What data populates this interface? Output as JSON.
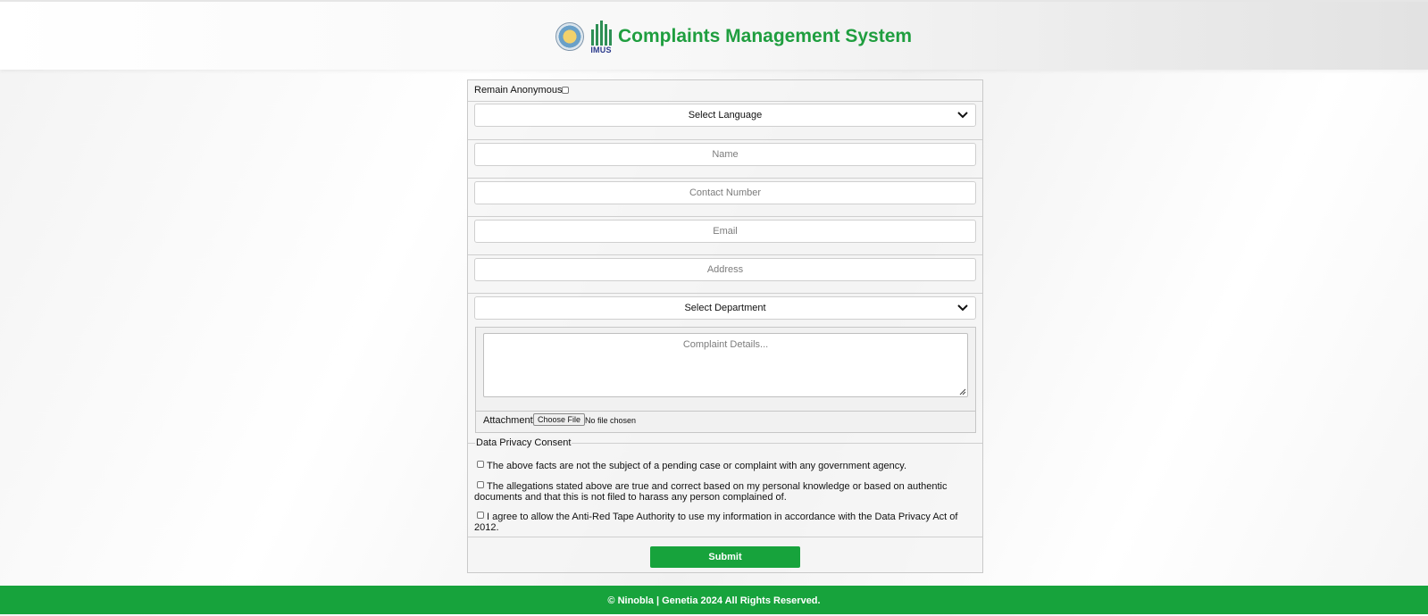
{
  "header": {
    "title": "Complaints Management System",
    "logo_text": "IMUS"
  },
  "form": {
    "anonymous_label": "Remain Anonymous:",
    "language_select": "Select Language",
    "name_placeholder": "Name",
    "contact_placeholder": "Contact Number",
    "email_placeholder": "Email",
    "address_placeholder": "Address",
    "department_select": "Select Department",
    "details_placeholder": "Complaint Details...",
    "attachment_label": "Attachment:",
    "file_button": "Choose File",
    "file_status": "No file chosen"
  },
  "privacy": {
    "legend": "Data Privacy Consent",
    "items": [
      "The above facts are not the subject of a pending case or complaint with any government agency.",
      "The allegations stated above are true and correct based on my personal knowledge or based on authentic documents and that this is not filed to harass any person complained of.",
      "I agree to allow the Anti-Red Tape Authority to use my information in accordance with the Data Privacy Act of 2012."
    ]
  },
  "submit_label": "Submit",
  "footer": {
    "text": "© Ninobla | Genetia 2024 All Rights Reserved."
  },
  "colors": {
    "brand_green": "#17a33c",
    "title_green": "#1f9e3f"
  }
}
